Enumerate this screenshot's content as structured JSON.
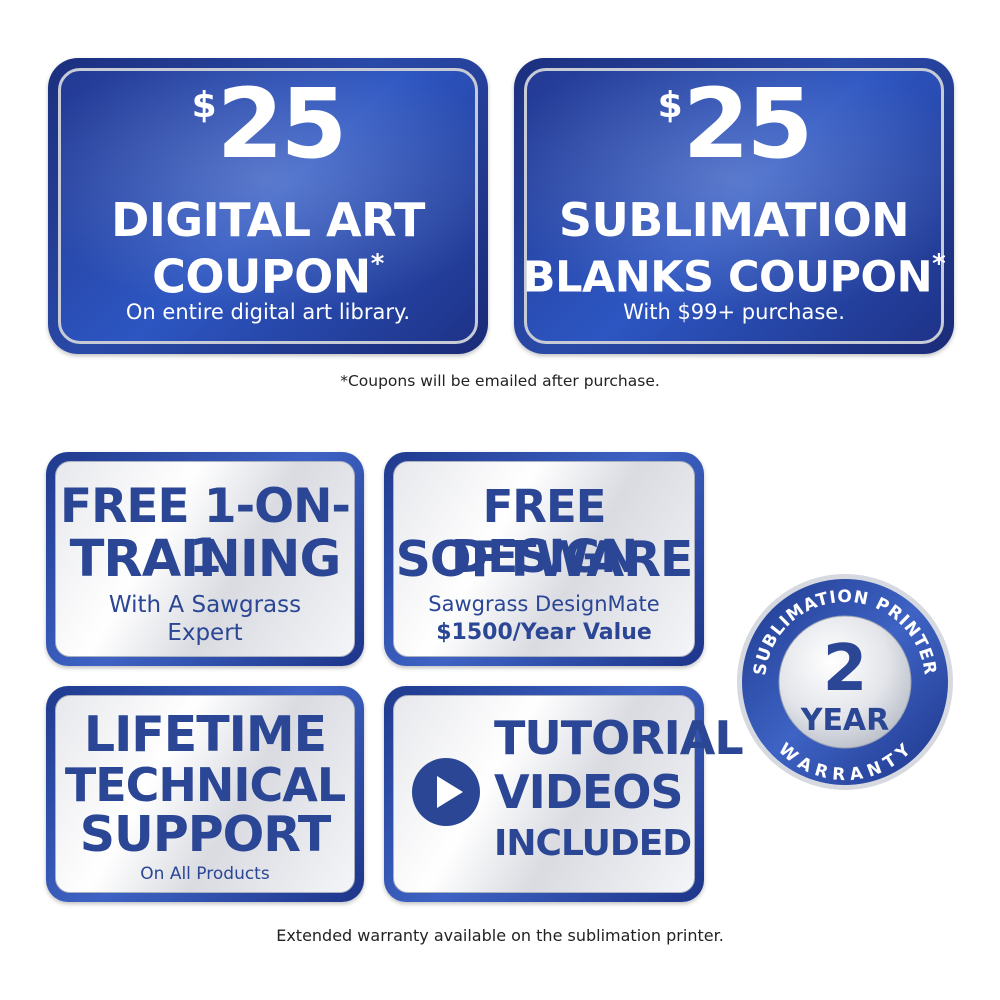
{
  "coupons": {
    "left": {
      "dollar": "$",
      "amount": "25",
      "title_line1": "DIGITAL ART",
      "title_line2": "COUPON",
      "asterisk": "*",
      "subtitle": "On entire digital art library."
    },
    "right": {
      "dollar": "$",
      "amount": "25",
      "title_line1": "SUBLIMATION",
      "title_line2": "BLANKS COUPON",
      "asterisk": "*",
      "subtitle": "With $99+ purchase."
    },
    "note": "*Coupons will be emailed after purchase."
  },
  "features": {
    "training": {
      "line1": "FREE 1-ON-1",
      "line2": "TRAINING",
      "sub1": "With A Sawgrass",
      "sub2": "Expert"
    },
    "design": {
      "line1": "FREE DESIGN",
      "line2": "SOFTWARE",
      "sub1": "Sawgrass DesignMate",
      "sub2": "$1500/Year Value"
    },
    "support": {
      "line1": "LIFETIME",
      "line2": "TECHNICAL",
      "line3": "SUPPORT",
      "sub1": "On All Products"
    },
    "videos": {
      "line1": "TUTORIAL",
      "line2": "VIDEOS",
      "line3": "INCLUDED",
      "icon": "play-icon"
    }
  },
  "warranty": {
    "arc_top": "SUBLIMATION PRINTER",
    "number": "2",
    "year": "YEAR",
    "arc_bottom": "WARRANTY"
  },
  "footer_note": "Extended warranty available on the sublimation printer.",
  "colors": {
    "coupon_blue": "#2a4aa8",
    "text_blue": "#2a4694",
    "silver": "#e7e8ec"
  }
}
